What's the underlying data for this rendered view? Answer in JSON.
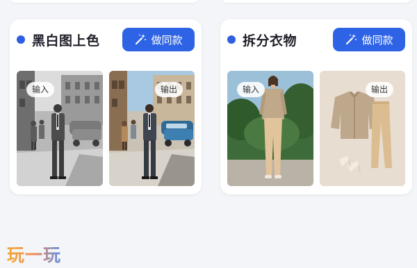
{
  "cards": [
    {
      "title": "黑白图上色",
      "button_label": "做同款",
      "input_tag": "输入",
      "output_tag": "输出"
    },
    {
      "title": "拆分衣物",
      "button_label": "做同款",
      "input_tag": "输入",
      "output_tag": "输出"
    }
  ],
  "watermark": "玩一玩",
  "colors": {
    "accent": "#2e63e6",
    "dot": "#2e5fe0",
    "title": "#1e1e28",
    "page_bg": "#f3f5f8"
  }
}
